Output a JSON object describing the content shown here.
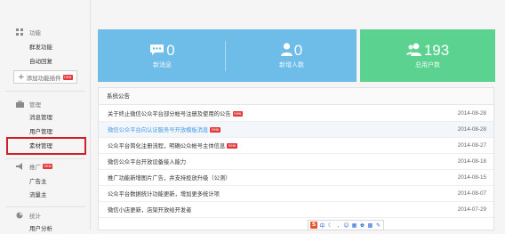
{
  "sidebar": {
    "sections": [
      {
        "title": "功能",
        "icon": "grid-icon",
        "items": [
          "群发功能",
          "自动回复"
        ]
      },
      {
        "title": "管理",
        "icon": "briefcase-icon",
        "items": [
          "消息管理",
          "用户管理",
          "素材管理"
        ]
      },
      {
        "title": "推广",
        "icon": "megaphone-icon",
        "badge": "new",
        "items": [
          "广告主",
          "流量主"
        ]
      },
      {
        "title": "统计",
        "icon": "chart-icon",
        "items": [
          "用户分析"
        ]
      }
    ],
    "add_plugin_label": "添加功能插件",
    "add_plugin_badge": "new",
    "highlighted_item": "素材管理"
  },
  "stats": [
    {
      "value": "0",
      "label": "新消息",
      "icon": "message-icon"
    },
    {
      "value": "0",
      "label": "新增人数",
      "icon": "user-icon"
    },
    {
      "value": "193",
      "label": "总用户数",
      "icon": "users-icon"
    }
  ],
  "colors": {
    "stat_blue": "#6ebde8",
    "stat_green": "#5bd290",
    "link_blue": "#459ae9",
    "highlight_red": "#d11f26",
    "badge_red": "#e4393c"
  },
  "notices": {
    "title": "系统公告",
    "items": [
      {
        "title": "关于终止微信公众平台部分帐号注册及使用的公告",
        "badge": "new",
        "date": "2014-08-28"
      },
      {
        "title": "微信公众平台向认证服务号开放模板消息",
        "badge": "new",
        "date": "2014-08-28",
        "highlighted": true
      },
      {
        "title": "公众平台简化注册流程，明确公众帐号主体信息",
        "badge": "new",
        "date": "2014-08-27"
      },
      {
        "title": "微信公众平台开放设备接入能力",
        "date": "2014-08-18"
      },
      {
        "title": "推广功能新增图片广告，并支持投放升级（公测）",
        "date": "2014-08-15"
      },
      {
        "title": "公众平台数据统计功能更新，增加更多统计项",
        "date": "2014-08-07"
      },
      {
        "title": "微信小店更新，店架开放给开发者",
        "date": "2014-07-29"
      }
    ]
  },
  "ime_toolbar": {
    "logo": "S",
    "label": "中"
  }
}
